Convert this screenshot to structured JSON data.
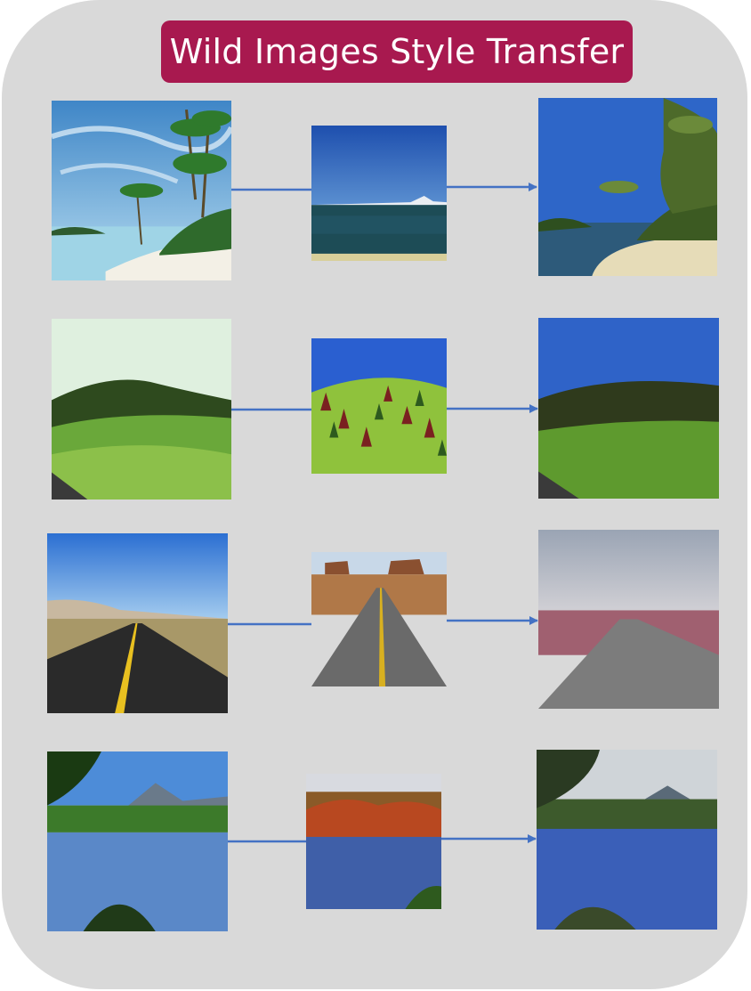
{
  "title": "Wild Images Style Transfer",
  "colors": {
    "panel": "#d9d9d9",
    "title_bg": "#a8194f",
    "title_text": "#ffffff",
    "connector": "#4472c4"
  },
  "rows": [
    {
      "input": "tropical beach with palm trees",
      "style": "calm sea with distant mountain",
      "output": "stylized tropical beach"
    },
    {
      "input": "green rolling hills with road",
      "style": "hills with pine trees",
      "output": "stylized green hills"
    },
    {
      "input": "desert highway with yellow lines",
      "style": "monument valley road",
      "output": "stylized desert road"
    },
    {
      "input": "mountain lake with reflections",
      "style": "autumn forest lake",
      "output": "stylized mountain lake"
    }
  ]
}
